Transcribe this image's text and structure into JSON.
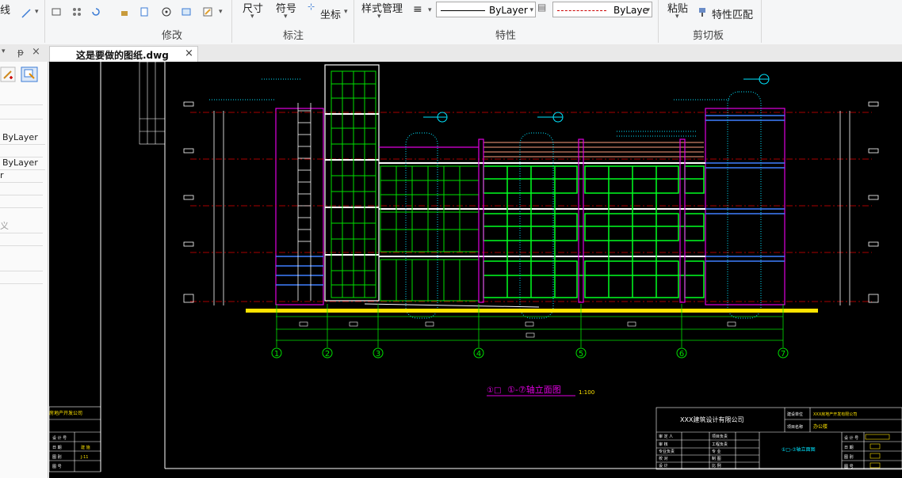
{
  "ribbon": {
    "partial_line_label": "线",
    "groups": {
      "modify": "修改",
      "annotation": "标注",
      "properties": "特性",
      "clipboard": "剪切板"
    },
    "dimension_label": "尺寸",
    "symbol_label": "符号",
    "coordinate_label": "坐标",
    "style_manager_label": "样式管理",
    "linetype_value": "ByLayer",
    "color_value": "ByLaye",
    "paste_label": "粘贴",
    "match_properties_label": "特性匹配"
  },
  "left_panel": {
    "pin_glyph": "ᵽ",
    "close_glyph": "×",
    "rows": [
      "ByLayer",
      "ByLayer",
      "r",
      "",
      "",
      "义",
      "",
      "",
      ""
    ]
  },
  "document_tab": {
    "title": "这是要做的图纸.dwg",
    "close_glyph": "×"
  },
  "drawing": {
    "axis_labels": [
      "1",
      "2",
      "3",
      "4",
      "5",
      "6",
      "7"
    ],
    "elevation_title": "①-⑦轴立面图",
    "elevation_title_prefix": "①□",
    "elevation_scale": "1:100",
    "left_company_partial": "房地产开发公司",
    "title_block": {
      "designer_company": "XXX建筑设计有限公司",
      "owner_label": "建设单位",
      "owner_value": "XXX房地产开发有限公司",
      "project_label": "项目名称",
      "project_value": "办公楼",
      "drawing_title": "①□-⑦轴立面图",
      "left_labels": [
        "审 定 人",
        "审 核",
        "专业负责",
        "校 对",
        "设 计"
      ],
      "mid_labels": [
        "项目负责",
        "工程负责",
        "专 业",
        "制 图",
        "比 例"
      ],
      "right_labels": [
        "设 计 号",
        "日 期",
        "图 别",
        "图 号"
      ],
      "small_left_labels": [
        "设 计 号",
        "日 期",
        "图 别",
        "图 号"
      ],
      "small_left_values": [
        "",
        "建 施",
        "J-11",
        ""
      ]
    }
  },
  "colors": {
    "canvas_bg": "#000000",
    "green": "#00e000",
    "magenta": "#e000e0",
    "cyan": "#00e5ff",
    "yellow": "#ffe400",
    "red": "#e00000",
    "salmon": "#ff9f7f",
    "blue": "#3f7fff",
    "white": "#ffffff"
  }
}
